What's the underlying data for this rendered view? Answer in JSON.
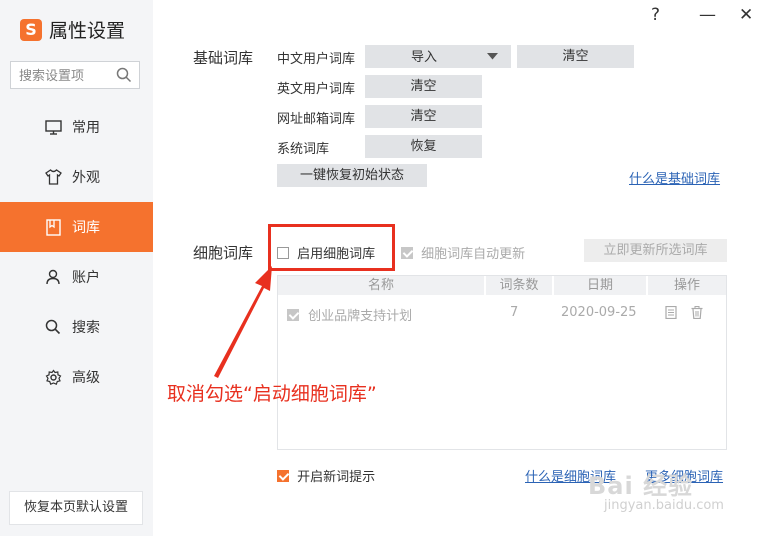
{
  "app": {
    "title": "属性设置",
    "logo_text": "S"
  },
  "search": {
    "placeholder": "搜索设置项"
  },
  "window_controls": {
    "help": "?",
    "minimize": "—",
    "close": "✕"
  },
  "sidebar": {
    "items": [
      {
        "label": "常用",
        "icon": "monitor-icon"
      },
      {
        "label": "外观",
        "icon": "shirt-icon"
      },
      {
        "label": "词库",
        "icon": "book-icon",
        "active": true
      },
      {
        "label": "账户",
        "icon": "user-icon"
      },
      {
        "label": "搜索",
        "icon": "search-icon"
      },
      {
        "label": "高级",
        "icon": "gear-icon"
      }
    ],
    "reset_label": "恢复本页默认设置"
  },
  "basic": {
    "section_title": "基础词库",
    "cn_user": {
      "label": "中文用户词库",
      "import": "导入",
      "clear": "清空"
    },
    "en_user": {
      "label": "英文用户词库",
      "clear": "清空"
    },
    "url_mail": {
      "label": "网址邮箱词库",
      "clear": "清空"
    },
    "system": {
      "label": "系统词库",
      "restore": "恢复"
    },
    "restore_all": "一键恢复初始状态",
    "help_link": "什么是基础词库"
  },
  "cell": {
    "section_title": "细胞词库",
    "enable_label": "启用细胞词库",
    "enable_checked": false,
    "auto_update_label": "细胞词库自动更新",
    "update_now": "立即更新所选词库",
    "table": {
      "headers": [
        "名称",
        "词条数",
        "日期",
        "操作"
      ],
      "rows": [
        {
          "name": "创业品牌支持计划",
          "count": "7",
          "date": "2020-09-25"
        }
      ]
    },
    "new_word_tip": "开启新词提示",
    "help_link": "什么是细胞词库",
    "more_link": "更多细胞词库"
  },
  "annotation": {
    "text": "取消勾选“启动细胞词库”",
    "color": "#e8301f"
  },
  "watermark": {
    "main": "Bai 经验",
    "sub": "jingyan.baidu.com"
  },
  "colors": {
    "accent": "#f5722e",
    "link": "#2b63b5",
    "annotation_red": "#e8301f"
  }
}
